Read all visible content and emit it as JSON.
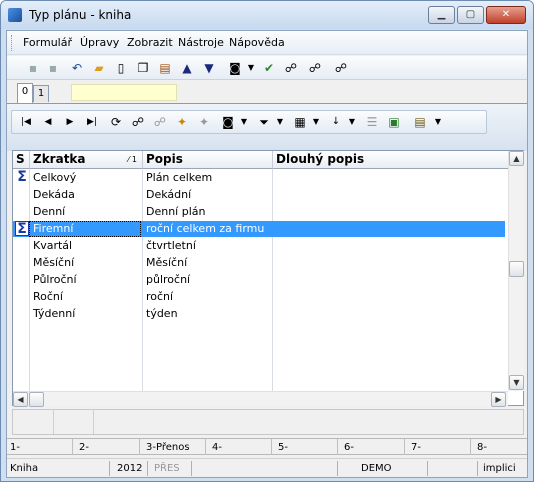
{
  "window": {
    "title": "Typ plánu - kniha",
    "minimize": "▁",
    "maximize": "▢",
    "close": "✕"
  },
  "menu": [
    "Formulář",
    "Úpravy",
    "Zobrazit",
    "Nástroje",
    "Nápověda"
  ],
  "tabs": [
    "0",
    "1"
  ],
  "grid": {
    "columns": [
      "S",
      "Zkratka",
      "Popis",
      "Dlouhý popis"
    ],
    "sort_marker": "⁄ 1",
    "rows": [
      {
        "s": "Σ",
        "zkratka": "Celkový",
        "popis": "Plán celkem",
        "dlouhy": ""
      },
      {
        "s": "",
        "zkratka": "Dekáda",
        "popis": "Dekádní",
        "dlouhy": ""
      },
      {
        "s": "",
        "zkratka": "Denní",
        "popis": "Denní plán",
        "dlouhy": ""
      },
      {
        "s": "Σ",
        "zkratka": "Firemní",
        "popis": "roční celkem za firmu",
        "dlouhy": ""
      },
      {
        "s": "",
        "zkratka": "Kvartál",
        "popis": "čtvrtletní",
        "dlouhy": ""
      },
      {
        "s": "",
        "zkratka": "Měsíční",
        "popis": "Měsíční",
        "dlouhy": ""
      },
      {
        "s": "",
        "zkratka": "Půlroční",
        "popis": "půlroční",
        "dlouhy": ""
      },
      {
        "s": "",
        "zkratka": "Roční",
        "popis": "roční",
        "dlouhy": ""
      },
      {
        "s": "",
        "zkratka": "Týdenní",
        "popis": "týden",
        "dlouhy": ""
      }
    ],
    "selected_index": 3
  },
  "fkeys": [
    "1-",
    "2-",
    "3-Přenos",
    "4-",
    "5-",
    "6-",
    "7-",
    "8-"
  ],
  "status": {
    "form": "Kniha",
    "year": "2012",
    "mode": "PŘES",
    "db": "DEMO",
    "user": "implici"
  },
  "colors": {
    "selection": "#3399ff",
    "sigma": "#1a3aa0"
  }
}
